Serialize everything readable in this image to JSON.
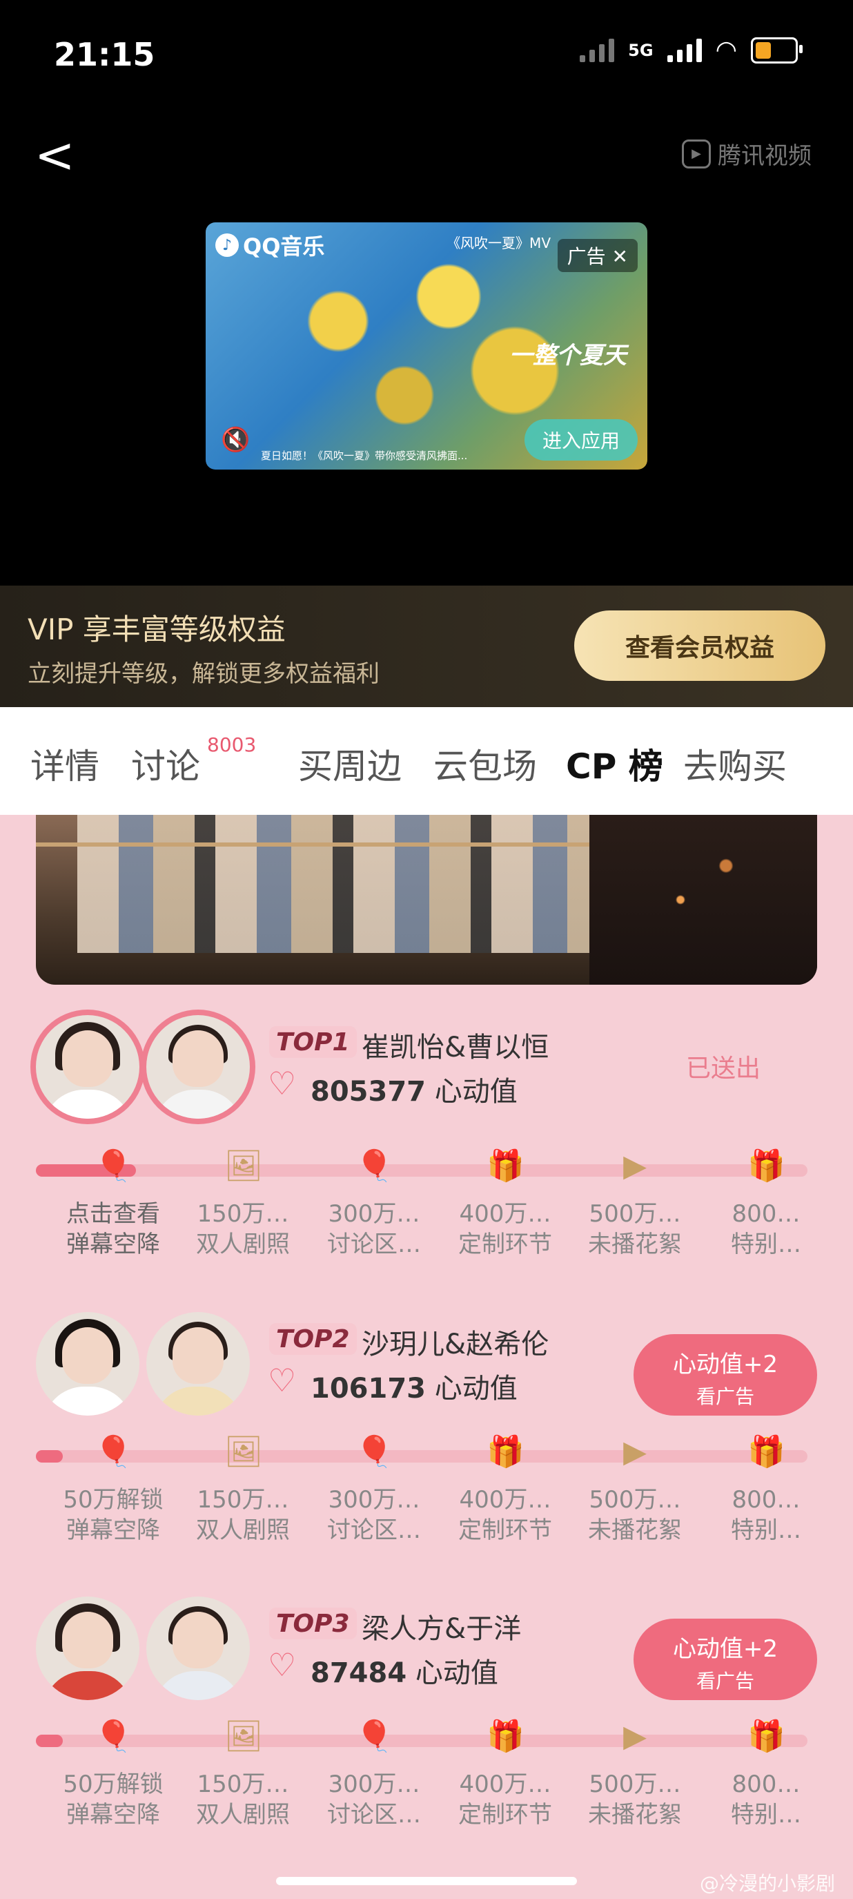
{
  "status_bar": {
    "time": "21:15",
    "network": "5G"
  },
  "header": {
    "back_glyph": "<",
    "platform_logo": "腾讯视频"
  },
  "ad": {
    "brand": "QQ音乐",
    "title": "《风吹一夏》MV",
    "tag": "广告 ✕",
    "slogan": "一整个夏天",
    "enter_button": "进入应用",
    "caption": "夏日如愿！《风吹一夏》带你感受清风拂面..."
  },
  "vip_banner": {
    "title": "VIP 享丰富等级权益",
    "subtitle": "立刻提升等级，解锁更多权益福利",
    "button": "查看会员权益"
  },
  "tabs": [
    {
      "label": "详情"
    },
    {
      "label": "讨论",
      "badge": "8003"
    },
    {
      "label": "买周边"
    },
    {
      "label": "云包场"
    },
    {
      "label": "CP 榜",
      "active": true
    },
    {
      "label": "去购买"
    }
  ],
  "cp_list": [
    {
      "rank": "TOP1",
      "names": "崔凯怡&曹以恒",
      "score": "805377",
      "score_unit": "心动值",
      "status": "已送出",
      "progress": 0.13,
      "milestones": [
        {
          "icon": "hot-air-balloon-icon",
          "line1": "点击查看",
          "line2": "弹幕空降"
        },
        {
          "icon": "photo-frame-icon",
          "line1": "150万…",
          "line2": "双人剧照"
        },
        {
          "icon": "hot-air-balloon-icon",
          "line1": "300万…",
          "line2": "讨论区…"
        },
        {
          "icon": "gift-box-icon",
          "line1": "400万…",
          "line2": "定制环节"
        },
        {
          "icon": "play-icon",
          "line1": "500万…",
          "line2": "未播花絮"
        },
        {
          "icon": "gift-box-icon",
          "line1": "800…",
          "line2": "特别…"
        }
      ]
    },
    {
      "rank": "TOP2",
      "names": "沙玥儿&赵希伦",
      "score": "106173",
      "score_unit": "心动值",
      "button_line1": "心动值+2",
      "button_line2": "看广告",
      "progress": 0.02,
      "milestones": [
        {
          "icon": "hot-air-balloon-icon",
          "line1": "50万解锁",
          "line2": "弹幕空降"
        },
        {
          "icon": "photo-frame-icon",
          "line1": "150万…",
          "line2": "双人剧照"
        },
        {
          "icon": "hot-air-balloon-icon",
          "line1": "300万…",
          "line2": "讨论区…"
        },
        {
          "icon": "gift-box-icon",
          "line1": "400万…",
          "line2": "定制环节"
        },
        {
          "icon": "play-icon",
          "line1": "500万…",
          "line2": "未播花絮"
        },
        {
          "icon": "gift-box-icon",
          "line1": "800…",
          "line2": "特别…"
        }
      ]
    },
    {
      "rank": "TOP3",
      "names": "梁人方&于洋",
      "score": "87484",
      "score_unit": "心动值",
      "button_line1": "心动值+2",
      "button_line2": "看广告",
      "progress": 0.02,
      "milestones": [
        {
          "icon": "hot-air-balloon-icon",
          "line1": "50万解锁",
          "line2": "弹幕空降"
        },
        {
          "icon": "photo-frame-icon",
          "line1": "150万…",
          "line2": "双人剧照"
        },
        {
          "icon": "hot-air-balloon-icon",
          "line1": "300万…",
          "line2": "讨论区…"
        },
        {
          "icon": "gift-box-icon",
          "line1": "400万…",
          "line2": "定制环节"
        },
        {
          "icon": "play-icon",
          "line1": "500万…",
          "line2": "未播花絮"
        },
        {
          "icon": "gift-box-icon",
          "line1": "800…",
          "line2": "特别…"
        }
      ]
    }
  ],
  "watermark": "@冷漫的小影剧"
}
